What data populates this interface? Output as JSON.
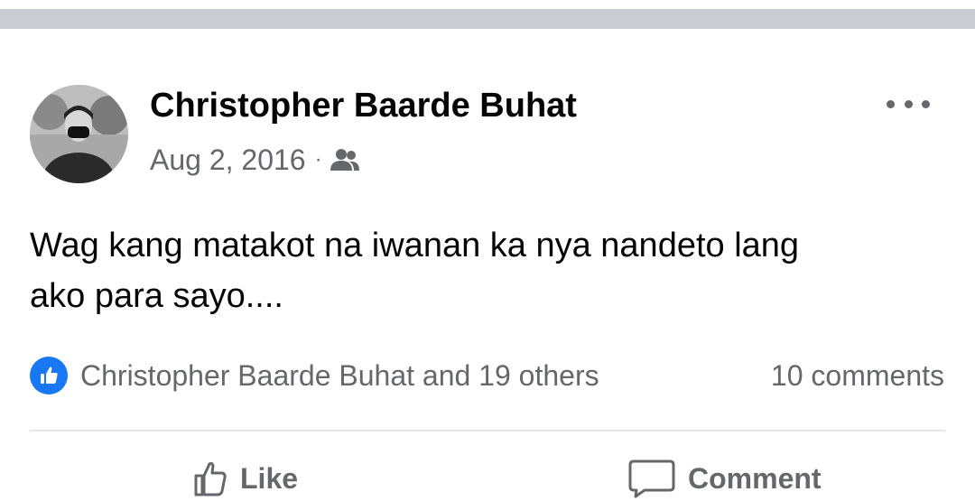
{
  "post": {
    "author": "Christopher Baarde Buhat",
    "date": "Aug 2, 2016",
    "separator": "·",
    "audience_icon": "friends-icon",
    "text_line1": "Wag kang matakot na iwanan ka nya nandeto lang",
    "text_line2": "ako para sayo....",
    "reactions_text": "Christopher Baarde Buhat and 19 others",
    "comments_text": "10 comments"
  },
  "actions": {
    "like_label": "Like",
    "comment_label": "Comment"
  },
  "colors": {
    "like_blue": "#1877f2",
    "secondary_text": "#65676b",
    "divider": "#c9ccd1"
  }
}
